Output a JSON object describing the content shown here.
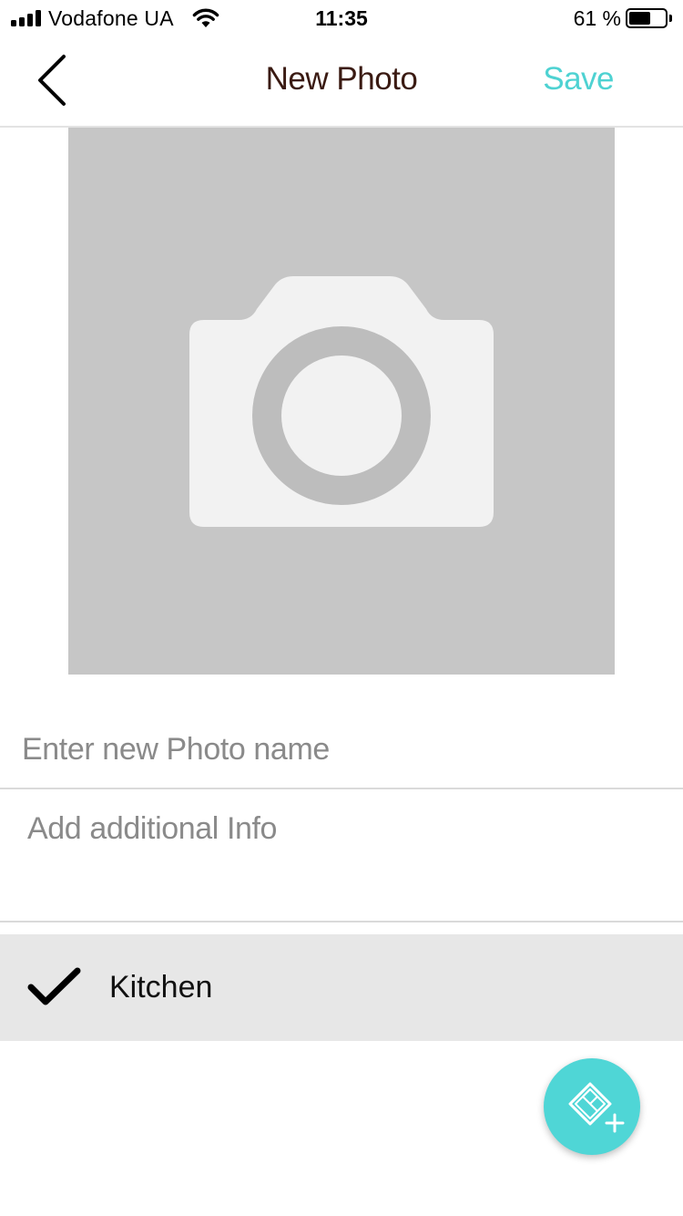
{
  "status_bar": {
    "carrier": "Vodafone UA",
    "time": "11:35",
    "battery_percent_label": "61 %",
    "battery_level": 0.61,
    "signal_icon": "signal-bars-icon",
    "wifi_icon": "wifi-icon",
    "battery_icon": "battery-icon"
  },
  "nav": {
    "back_icon": "chevron-left-icon",
    "title": "New Photo",
    "save_label": "Save"
  },
  "photo": {
    "placeholder_icon": "camera-icon"
  },
  "form": {
    "name_placeholder": "Enter new Photo name",
    "name_value": "",
    "info_placeholder": "Add additional Info",
    "info_value": ""
  },
  "room": {
    "label": "Kitchen",
    "selected": true,
    "check_icon": "checkmark-icon"
  },
  "fab": {
    "icon": "add-room-icon"
  },
  "colors": {
    "accent": "#4ED2D2",
    "title": "#3A1A12",
    "photo_bg": "#C6C6C6",
    "row_bg": "#E7E7E7"
  }
}
